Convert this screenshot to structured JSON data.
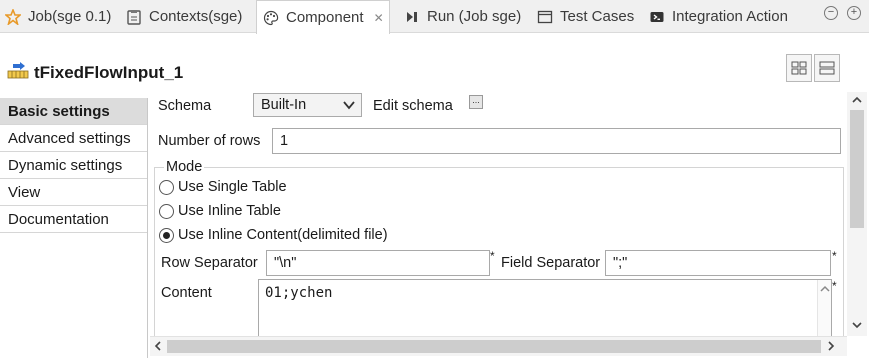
{
  "tabs": [
    {
      "label": "Job(sge 0.1)",
      "icon": "job-star-icon"
    },
    {
      "label": "Contexts(sge)",
      "icon": "contexts-icon"
    },
    {
      "label": "Component",
      "icon": "palette-icon",
      "active": true
    },
    {
      "label": "Run (Job sge)",
      "icon": "run-icon"
    },
    {
      "label": "Test Cases",
      "icon": "test-cases-icon"
    },
    {
      "label": "Integration Action",
      "icon": "integration-icon"
    }
  ],
  "tab_close": "✕",
  "component": {
    "title": "tFixedFlowInput_1",
    "icon": "fixed-flow-input-icon"
  },
  "nav": [
    "Basic settings",
    "Advanced settings",
    "Dynamic settings",
    "View",
    "Documentation"
  ],
  "form": {
    "schema_label": "Schema",
    "schema_value": "Built-In",
    "edit_schema_label": "Edit schema",
    "edit_schema_button": "...",
    "rows_label": "Number of rows",
    "rows_value": "1",
    "mode_label": "Mode",
    "mode_options": [
      "Use Single Table",
      "Use Inline Table",
      "Use Inline Content(delimited file)"
    ],
    "mode_selected_index": 2,
    "row_sep_label": "Row Separator",
    "row_sep_value": "\"\\n\"",
    "field_sep_label": "Field Separator",
    "field_sep_value": "\";\"",
    "content_label": "Content",
    "content_value": "01;ychen",
    "required_mark": "*"
  },
  "colors": {
    "tab_bg": "#f0f0f0",
    "selected_nav": "#dcdcdc",
    "accent_star": "#e89a2a"
  }
}
